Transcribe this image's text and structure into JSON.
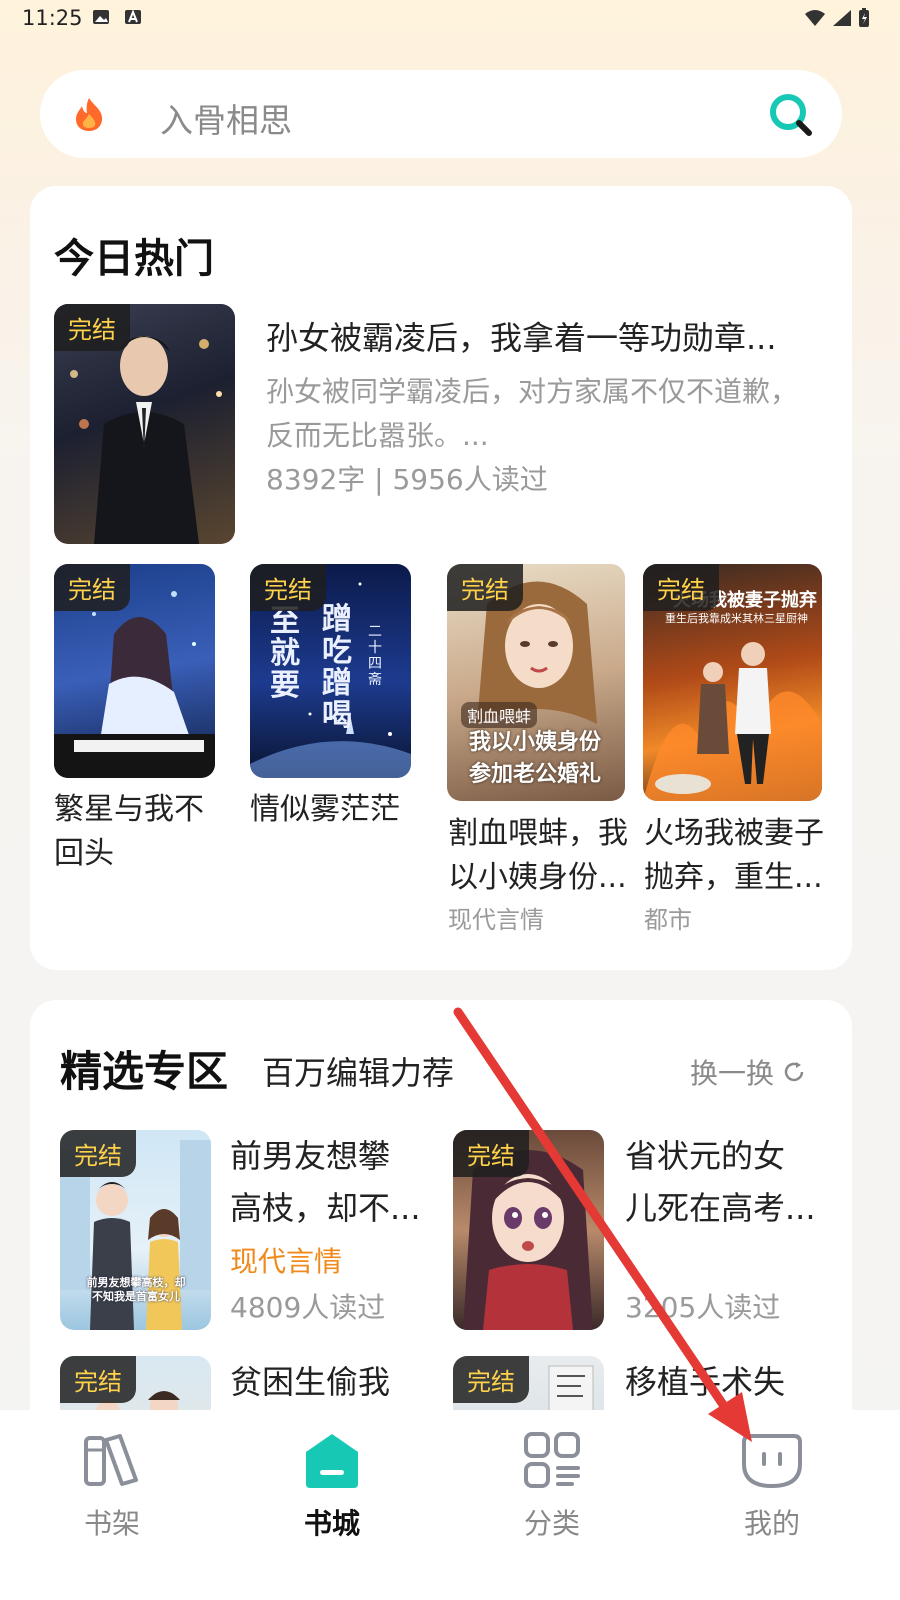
{
  "status_bar": {
    "time": "11:25"
  },
  "search": {
    "placeholder": "入骨相思"
  },
  "hot": {
    "title": "今日热门",
    "featured": {
      "tag": "完结",
      "title": "孙女被霸凌后，我拿着一等功勋章...",
      "desc_line1": "孙女被同学霸凌后，对方家属不仅不道歉，",
      "desc_line2": "反而无比嚣张。...",
      "meta": "8392字 | 5956人读过"
    },
    "books": [
      {
        "tag": "完结",
        "title_line1": "繁星与我不",
        "title_line2": "回头",
        "category": ""
      },
      {
        "tag": "完结",
        "title_line1": "情似雾茫茫",
        "title_line2": "",
        "category": "",
        "cover_text1": "至就要",
        "cover_text2": "蹭吃蹭喝",
        "cover_text3": "二十四斋"
      },
      {
        "tag": "完结",
        "title_line1": "割血喂蚌，我",
        "title_line2": "以小姨身份...",
        "category": "现代言情",
        "cover_text1": "割血喂蚌",
        "cover_text2": "我以小姨身份",
        "cover_text3": "参加老公婚礼"
      },
      {
        "tag": "完结",
        "title_line1": "火场我被妻子",
        "title_line2": "抛弃，重生...",
        "category": "都市",
        "cover_text1": "火场我被妻子抛弃",
        "cover_text2": "重生后我靠成米其林三星厨神"
      }
    ]
  },
  "picks": {
    "title": "精选专区",
    "subtitle": "百万编辑力荐",
    "refresh": "换一换",
    "items": [
      {
        "tag": "完结",
        "title_line1": "前男友想攀",
        "title_line2": "高枝，却不...",
        "category": "现代言情",
        "readers": "4809人读过",
        "cover_text": "前男友想攀高枝，却不知我是首富女儿"
      },
      {
        "tag": "完结",
        "title_line1": "省状元的女",
        "title_line2": "儿死在高考...",
        "category": "",
        "readers": "3205人读过"
      },
      {
        "tag": "完结",
        "title_line1": "贫困生偷我",
        "title_line2": ""
      },
      {
        "tag": "完结",
        "title_line1": "移植手术失",
        "title_line2": ""
      }
    ]
  },
  "nav": [
    {
      "label": "书架",
      "icon": "bookshelf-icon"
    },
    {
      "label": "书城",
      "icon": "bookstore-icon",
      "active": true
    },
    {
      "label": "分类",
      "icon": "category-icon"
    },
    {
      "label": "我的",
      "icon": "profile-icon"
    }
  ],
  "colors": {
    "accent": "#17c9b4",
    "tag_text": "#ffd24a",
    "category_orange": "#f08a1c",
    "annotation": "#e53935"
  }
}
